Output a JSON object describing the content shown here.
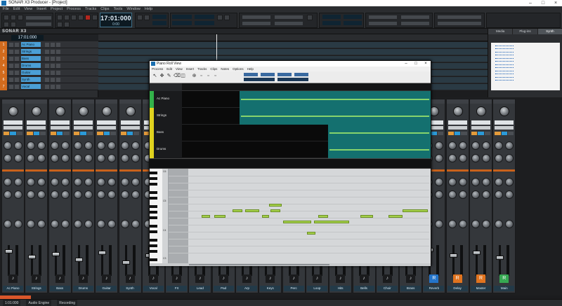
{
  "window": {
    "title": "SONAR X3 Producer - [Project]"
  },
  "menubar": [
    "File",
    "Edit",
    "View",
    "Insert",
    "Project",
    "Process",
    "Tracks",
    "Clips",
    "Tools",
    "Window",
    "Help"
  ],
  "controlbar": {
    "time_main": "17:01:000",
    "time_sub": "0:00"
  },
  "logo": "SONAR X3",
  "trackpane": {
    "time": "17:01:000",
    "tracks": [
      {
        "num": "1",
        "name": "Ac Piano"
      },
      {
        "num": "2",
        "name": "Strings"
      },
      {
        "num": "3",
        "name": "Bass"
      },
      {
        "num": "4",
        "name": "Drums"
      },
      {
        "num": "5",
        "name": "Guitar"
      },
      {
        "num": "6",
        "name": "Synth"
      },
      {
        "num": "7",
        "name": "Vocal"
      }
    ]
  },
  "browser": {
    "tabs": [
      "Media",
      "Plug-ins",
      "Synth"
    ]
  },
  "floatwin": {
    "title": "Piano Roll View",
    "menu": [
      "Process",
      "Edit",
      "View",
      "Insert",
      "Tracks",
      "Clips",
      "Notes",
      "Options",
      "Help"
    ],
    "tracks": [
      {
        "name": "Ac Piano",
        "color": "#33b24a"
      },
      {
        "name": "Strings",
        "color": "#e0d21e"
      },
      {
        "name": "Bass",
        "color": "#e0d21e"
      },
      {
        "name": "Drums",
        "color": "#e0d21e"
      }
    ],
    "octaves": [
      "C6",
      "C5",
      "C4",
      "C3"
    ]
  },
  "mixer": {
    "strips": [
      {
        "name": "Ac Piano",
        "icon": "♪"
      },
      {
        "name": "Strings",
        "icon": "♪"
      },
      {
        "name": "Bass",
        "icon": "♪"
      },
      {
        "name": "Drums",
        "icon": "♪"
      },
      {
        "name": "Guitar",
        "icon": "♪"
      },
      {
        "name": "Synth",
        "icon": "♪"
      },
      {
        "name": "Vocal",
        "icon": "♪"
      },
      {
        "name": "FX",
        "icon": "♪"
      },
      {
        "name": "Lead",
        "icon": "♪"
      },
      {
        "name": "Pad",
        "icon": "♪"
      },
      {
        "name": "Arp",
        "icon": "♪"
      },
      {
        "name": "Keys",
        "icon": "♪"
      },
      {
        "name": "Perc",
        "icon": "♪"
      },
      {
        "name": "Loop",
        "icon": "♪"
      },
      {
        "name": "Hits",
        "icon": "♪"
      },
      {
        "name": "Bells",
        "icon": "♪"
      },
      {
        "name": "Choir",
        "icon": "♪"
      },
      {
        "name": "Brass",
        "icon": "♪"
      },
      {
        "name": "Reverb",
        "icon": "R"
      },
      {
        "name": "Delay",
        "icon": "R"
      },
      {
        "name": "Master",
        "icon": "R"
      },
      {
        "name": "Main",
        "icon": "R"
      }
    ]
  },
  "status": [
    "1:01:000",
    "Audio Engine",
    "Recording"
  ]
}
